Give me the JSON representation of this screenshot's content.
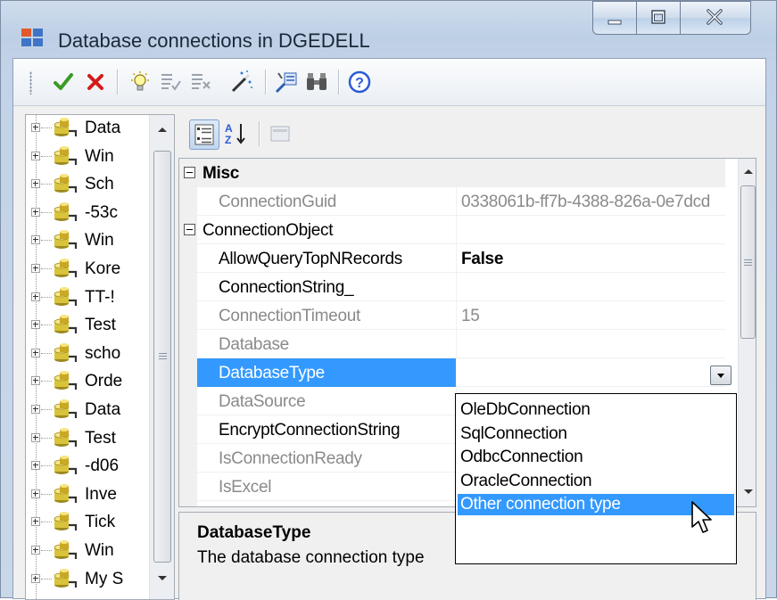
{
  "window": {
    "title": "Database connections in DGEDELL",
    "controls": {
      "minimize_icon": "minimize-icon",
      "maximize_icon": "maximize-icon",
      "close_icon": "close-icon"
    }
  },
  "toolbar": {
    "buttons": [
      {
        "icon": "checkmark-icon",
        "color": "#3a9a24"
      },
      {
        "icon": "red-x-icon",
        "color": "#d51a1a"
      },
      {
        "icon": "lightbulb-icon"
      },
      {
        "icon": "list-check-icon"
      },
      {
        "icon": "list-x-icon"
      },
      {
        "icon": "wand-icon"
      },
      {
        "icon": "wizard-icon"
      },
      {
        "icon": "binoculars-icon"
      },
      {
        "icon": "help-icon",
        "color": "#2a5bd7"
      }
    ]
  },
  "tree": {
    "items": [
      {
        "label": "Data"
      },
      {
        "label": "Win"
      },
      {
        "label": "Sch"
      },
      {
        "label": "-53c"
      },
      {
        "label": "Win"
      },
      {
        "label": "Kore"
      },
      {
        "label": "TT-!"
      },
      {
        "label": "Test"
      },
      {
        "label": "scho"
      },
      {
        "label": "Orde"
      },
      {
        "label": "Data"
      },
      {
        "label": "Test"
      },
      {
        "label": "-d06"
      },
      {
        "label": "Inve"
      },
      {
        "label": "Tick"
      },
      {
        "label": "Win"
      },
      {
        "label": "My S"
      }
    ]
  },
  "property_grid": {
    "toolbar": {
      "categorized_icon": "categorized-icon",
      "alphabetical_icon": "sort-az-icon",
      "pages_icon": "property-pages-icon"
    },
    "rows": [
      {
        "kind": "category",
        "name": "Misc"
      },
      {
        "kind": "prop",
        "name": "ConnectionGuid",
        "value": "0338061b-ff7b-4388-826a-0e7dcd",
        "dim": true
      },
      {
        "kind": "category2",
        "name": "ConnectionObject"
      },
      {
        "kind": "prop",
        "name": "AllowQueryTopNRecords",
        "value": "False",
        "bold_value": true
      },
      {
        "kind": "prop",
        "name": "ConnectionString_",
        "value": ""
      },
      {
        "kind": "prop",
        "name": "ConnectionTimeout",
        "value": "15",
        "dim": true
      },
      {
        "kind": "prop",
        "name": "Database",
        "value": "",
        "dim": true
      },
      {
        "kind": "selected",
        "name": "DatabaseType",
        "value": ""
      },
      {
        "kind": "prop",
        "name": "DataSource",
        "value": "",
        "dim": true
      },
      {
        "kind": "prop",
        "name": "EncryptConnectionString",
        "value": ""
      },
      {
        "kind": "prop",
        "name": "IsConnectionReady",
        "value": "",
        "dim": true
      },
      {
        "kind": "prop",
        "name": "IsExcel",
        "value": "",
        "dim": true
      }
    ],
    "dropdown": {
      "options": [
        "OleDbConnection",
        "SqlConnection",
        "OdbcConnection",
        "OracleConnection",
        "Other connection type"
      ],
      "selected_index": 4
    },
    "description": {
      "title": "DatabaseType",
      "text": "The database connection type"
    }
  },
  "colors": {
    "selection": "#3399ff",
    "title_text": "#1b2838"
  }
}
